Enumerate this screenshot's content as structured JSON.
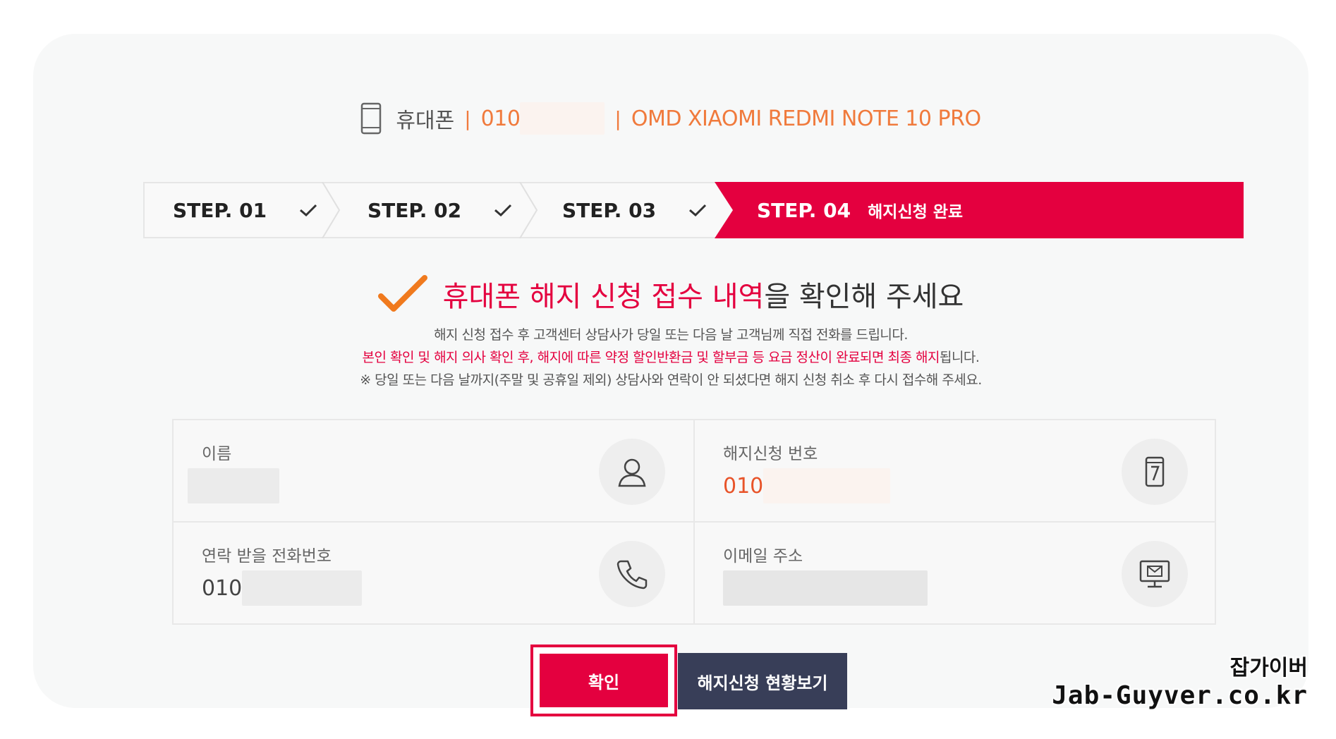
{
  "header": {
    "device_label": "휴대폰",
    "separator": "|",
    "phone_prefix": "010",
    "model": "OMD XIAOMI REDMI NOTE 10 PRO"
  },
  "steps": {
    "items": [
      {
        "label": "STEP. 01"
      },
      {
        "label": "STEP. 02"
      },
      {
        "label": "STEP. 03"
      }
    ],
    "active": {
      "label": "STEP. 04",
      "sub": "해지신청 완료"
    }
  },
  "headline": {
    "red_part": "휴대폰 해지 신청 접수 내역",
    "dark_part": "을 확인해 주세요"
  },
  "description": {
    "line1": "해지 신청 접수 후 고객센터 상담사가 당일 또는 다음 날 고객님께 직접 전화를 드립니다.",
    "line2_red": "본인 확인 및 해지 의사 확인 후, 해지에 따른 약정 할인반환금 및 할부금 등 요금 정산이 완료되면 최종 해지",
    "line2_dark": "됩니다.",
    "line3": "※ 당일 또는 다음 날까지(주말 및 공휴일 제외) 상담사와 연락이 안 되셨다면 해지 신청 취소 후 다시 접수해 주세요."
  },
  "info": {
    "name_label": "이름",
    "request_number_label": "해지신청 번호",
    "request_number_prefix": "010",
    "contact_label": "연락 받을 전화번호",
    "contact_prefix": "010",
    "email_label": "이메일 주소"
  },
  "buttons": {
    "confirm": "확인",
    "view_status": "해지신청 현황보기"
  },
  "watermark": {
    "line1": "잡가이버",
    "line2": "Jab-Guyver.co.kr"
  },
  "colors": {
    "accent_red": "#e4003f",
    "accent_orange": "#f07a3c",
    "navy": "#383e58"
  }
}
